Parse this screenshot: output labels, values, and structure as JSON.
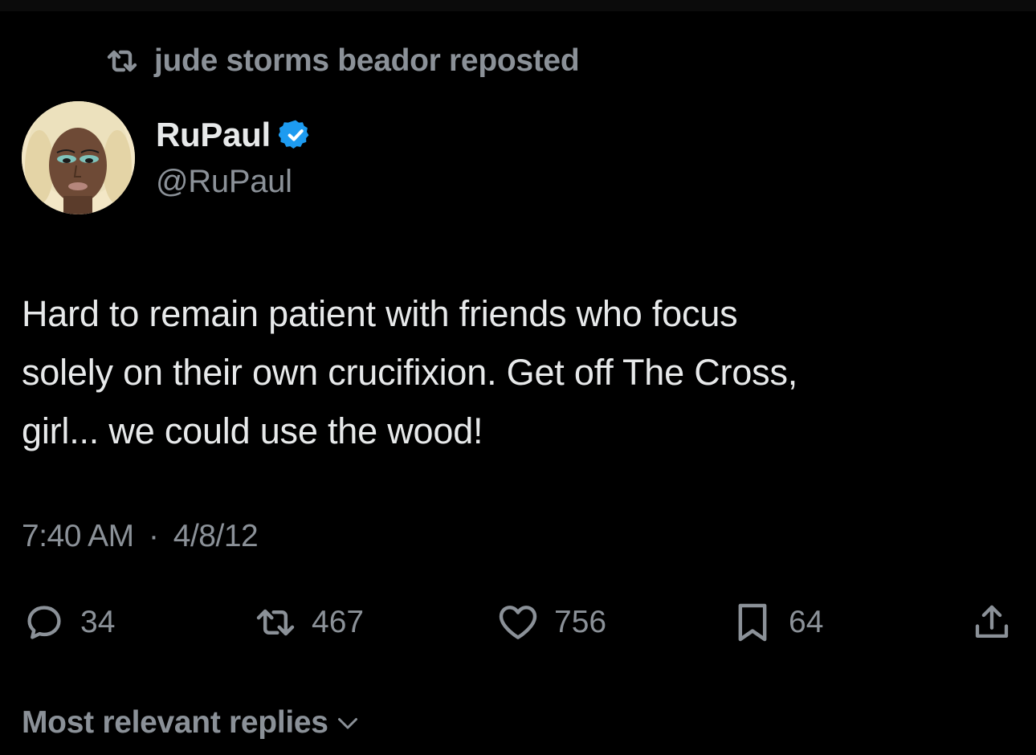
{
  "repost": {
    "label": "jude storms beador reposted",
    "icon": "repost-icon"
  },
  "author": {
    "display_name": "RuPaul",
    "handle": "@RuPaul",
    "verified_icon": "verified-badge-icon",
    "verified_color": "#1d9bf0"
  },
  "tweet": {
    "lines": [
      "Hard to remain patient with friends who focus",
      "solely on their own crucifixion. Get off The Cross,",
      "girl... we could use the wood!"
    ],
    "time": "7:40 AM",
    "separator": "·",
    "date": "4/8/12"
  },
  "actions": {
    "replies": {
      "count": "34",
      "icon": "reply-icon"
    },
    "reposts": {
      "count": "467",
      "icon": "repost-icon"
    },
    "likes": {
      "count": "756",
      "icon": "heart-icon"
    },
    "bookmarks": {
      "count": "64",
      "icon": "bookmark-icon"
    },
    "share": {
      "icon": "share-icon"
    }
  },
  "replies_filter": {
    "label": "Most relevant replies",
    "icon": "chevron-down-icon"
  },
  "colors": {
    "background": "#000000",
    "text_primary": "#e7e9ea",
    "text_secondary": "#8b9198",
    "accent": "#1d9bf0"
  }
}
